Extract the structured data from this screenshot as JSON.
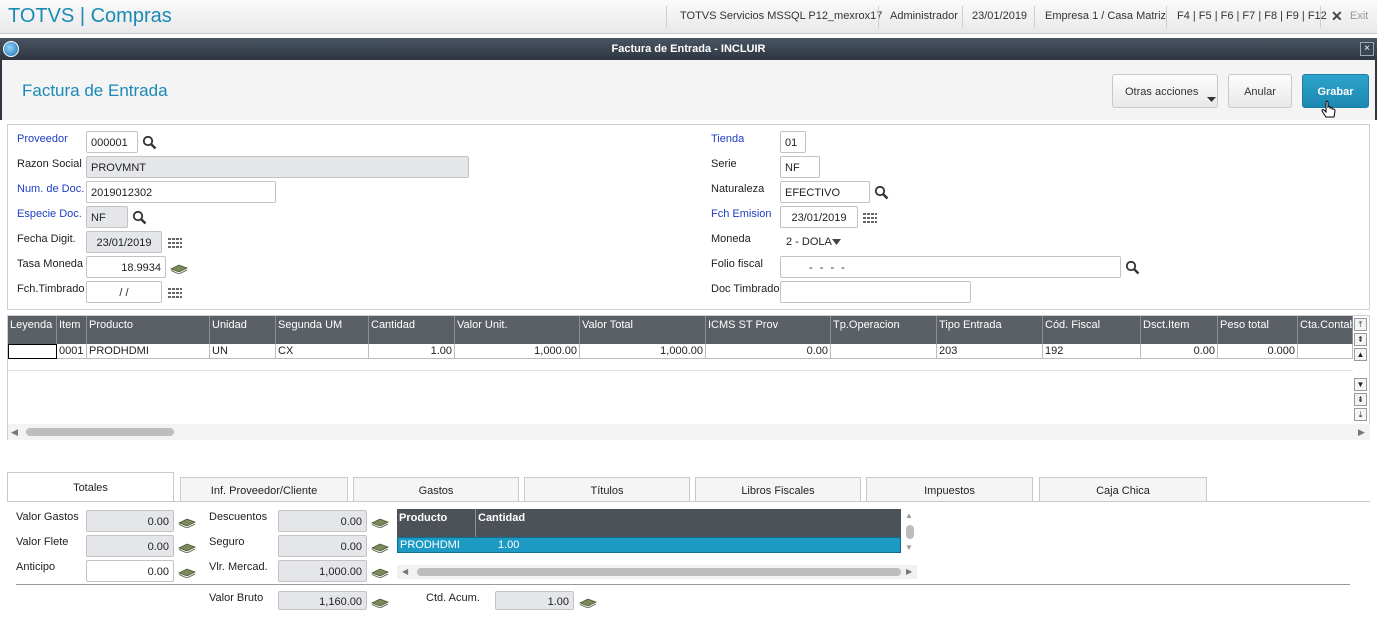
{
  "topbar": {
    "app_title": "TOTVS | Compras",
    "server": "TOTVS Servicios MSSQL P12_mexrox17",
    "user": "Administrador",
    "date": "23/01/2019",
    "company": "Empresa 1 / Casa Matriz",
    "shortcuts": "F4 | F5 | F6 | F7 | F8 | F9 | F12",
    "exit_label": "Exit"
  },
  "window": {
    "title": "Factura de Entrada - INCLUIR",
    "close_glyph": "×"
  },
  "header": {
    "page_title": "Factura de Entrada",
    "more_actions_label": "Otras acciones",
    "cancel_label": "Anular",
    "save_label": "Grabar"
  },
  "form": {
    "left": {
      "proveedor": {
        "label": "Proveedor",
        "value": "000001"
      },
      "razon_social": {
        "label": "Razon Social",
        "value": "PROVMNT"
      },
      "num_doc": {
        "label": "Num. de Doc.",
        "value": "2019012302"
      },
      "especie_doc": {
        "label": "Especie Doc.",
        "value": "NF"
      },
      "fecha_digit": {
        "label": "Fecha Digit.",
        "value": "23/01/2019"
      },
      "tasa_moneda": {
        "label": "Tasa Moneda",
        "value": "18.9934"
      },
      "fch_timbrado": {
        "label": "Fch.Timbrado",
        "value": "/ /"
      }
    },
    "right": {
      "tienda": {
        "label": "Tienda",
        "value": "01"
      },
      "serie": {
        "label": "Serie",
        "value": "NF"
      },
      "naturaleza": {
        "label": "Naturaleza",
        "value": "EFECTIVO"
      },
      "fch_emision": {
        "label": "Fch Emision",
        "value": "23/01/2019"
      },
      "moneda": {
        "label": "Moneda",
        "value": "2 - DOLA"
      },
      "folio_fiscal": {
        "label": "Folio fiscal",
        "value": "-   -   -   -"
      },
      "doc_timbrado": {
        "label": "Doc Timbrado",
        "value": ""
      }
    }
  },
  "grid": {
    "columns": [
      "Leyenda",
      "Item",
      "Producto",
      "Unidad",
      "Segunda UM",
      "Cantidad",
      "Valor Unit.",
      "Valor Total",
      "ICMS ST Prov",
      "Tp.Operacion",
      "Tipo Entrada",
      "Cód. Fiscal",
      "Dsct.Item",
      "Peso total",
      "Cta.Contable"
    ],
    "rows": [
      [
        "",
        "0001",
        "PRODHDMI",
        "UN",
        "CX",
        "1.00",
        "1,000.00",
        "1,000.00",
        "0.00",
        "",
        "203",
        "192",
        "0.00",
        "0.000",
        ""
      ]
    ]
  },
  "tabs": [
    "Totales",
    "Inf. Proveedor/Cliente",
    "Gastos",
    "Títulos",
    "Libros Fiscales",
    "Impuestos",
    "Caja Chica"
  ],
  "totales": {
    "valor_gastos": {
      "label": "Valor Gastos",
      "value": "0.00"
    },
    "valor_flete": {
      "label": "Valor Flete",
      "value": "0.00"
    },
    "anticipo": {
      "label": "Anticipo",
      "value": "0.00"
    },
    "descuentos": {
      "label": "Descuentos",
      "value": "0.00"
    },
    "seguro": {
      "label": "Seguro",
      "value": "0.00"
    },
    "vlr_mercad": {
      "label": "Vlr. Mercad.",
      "value": "1,000.00"
    },
    "valor_bruto": {
      "label": "Valor Bruto",
      "value": "1,160.00"
    },
    "ctd_acum": {
      "label": "Ctd. Acum.",
      "value": "1.00"
    },
    "mini_grid": {
      "columns": [
        "Producto",
        "Cantidad"
      ],
      "rows": [
        [
          "PRODHDMI",
          "1.00"
        ]
      ]
    }
  },
  "colors": {
    "accent": "#1a8ab5",
    "required_label": "#1f3dc4",
    "grid_header": "#5b6066",
    "selected_row": "#1c9ac4"
  }
}
